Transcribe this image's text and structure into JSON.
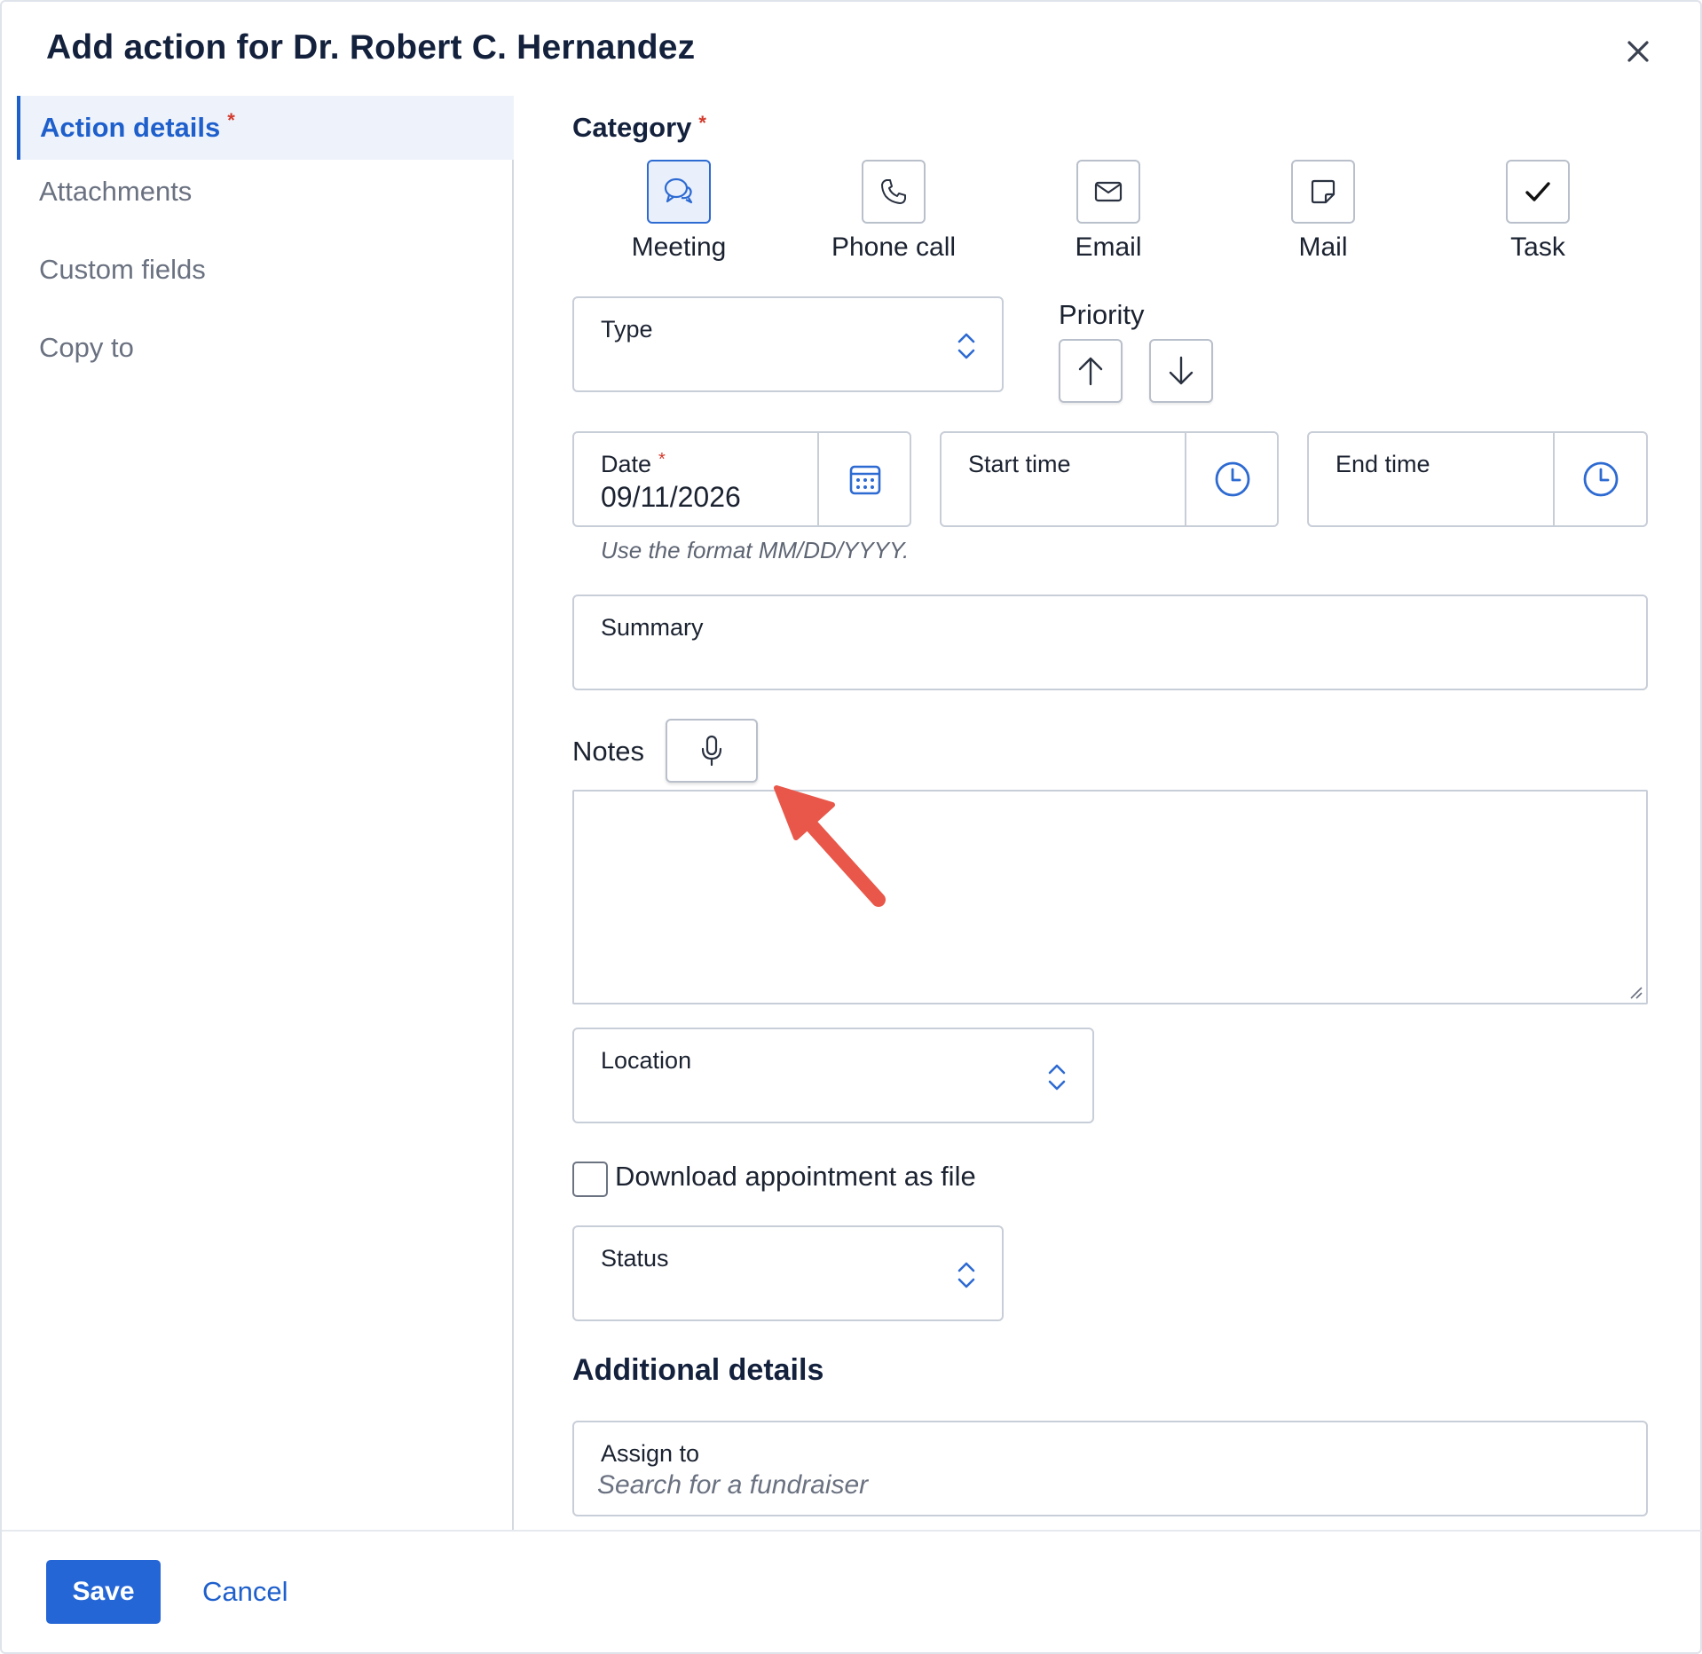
{
  "dialog": {
    "title": "Add action for Dr. Robert C. Hernandez",
    "close_icon": "close-icon"
  },
  "sidebar": {
    "items": [
      {
        "label": "Action details",
        "active": true,
        "required": "*"
      },
      {
        "label": "Attachments"
      },
      {
        "label": "Custom fields"
      },
      {
        "label": "Copy to"
      }
    ]
  },
  "category": {
    "label": "Category",
    "required": "*",
    "options": [
      {
        "label": "Meeting",
        "icon": "chat-bubbles-icon",
        "selected": true
      },
      {
        "label": "Phone call",
        "icon": "phone-icon"
      },
      {
        "label": "Email",
        "icon": "envelope-icon"
      },
      {
        "label": "Mail",
        "icon": "note-icon"
      },
      {
        "label": "Task",
        "icon": "checkmark-icon"
      }
    ]
  },
  "type": {
    "label": "Type",
    "icon": "chevron-updown-icon"
  },
  "priority": {
    "label": "Priority",
    "up_icon": "arrow-up-icon",
    "down_icon": "arrow-down-icon"
  },
  "date": {
    "label": "Date",
    "required": "*",
    "value": "09/11/2026",
    "hint": "Use the format MM/DD/YYYY.",
    "icon": "calendar-icon"
  },
  "start_time": {
    "label": "Start time",
    "icon": "clock-icon"
  },
  "end_time": {
    "label": "End time",
    "icon": "clock-icon"
  },
  "summary": {
    "label": "Summary"
  },
  "notes": {
    "label": "Notes",
    "mic_icon": "microphone-icon"
  },
  "location": {
    "label": "Location",
    "icon": "chevron-updown-icon"
  },
  "download": {
    "label": "Download appointment as file",
    "checked": false
  },
  "status": {
    "label": "Status",
    "icon": "chevron-updown-icon"
  },
  "additional": {
    "heading": "Additional details",
    "assign_to": {
      "label": "Assign to",
      "placeholder": "Search for a fundraiser"
    }
  },
  "footer": {
    "save_label": "Save",
    "cancel_label": "Cancel"
  },
  "colors": {
    "accent": "#2566d6",
    "required": "#d33a2c",
    "annotation_arrow": "#e8574a"
  }
}
